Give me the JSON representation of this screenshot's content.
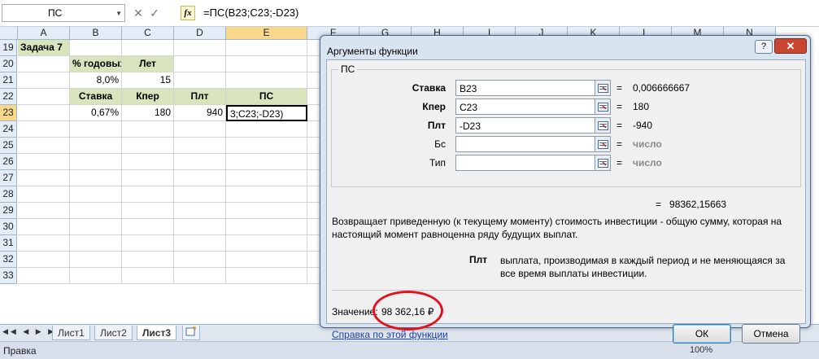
{
  "formula_bar": {
    "name_box": "ПС",
    "cancel_glyph": "✕",
    "enter_glyph": "✓",
    "fx_label": "fx",
    "formula": "=ПС(B23;C23;-D23)"
  },
  "grid": {
    "columns": [
      "A",
      "B",
      "C",
      "D",
      "E",
      "F",
      "G",
      "H",
      "I",
      "J",
      "K",
      "L",
      "M",
      "N"
    ],
    "rows": [
      "19",
      "20",
      "21",
      "22",
      "23",
      "24",
      "25",
      "26",
      "27",
      "28",
      "29",
      "30",
      "31",
      "32",
      "33"
    ],
    "cells": {
      "A19": "Задача 7",
      "B20": "% годовых",
      "C20": "Лет",
      "B21": "8,0%",
      "C21": "15",
      "B22": "Ставка",
      "C22": "Кпер",
      "D22": "Плт",
      "E22": "ПС",
      "B23": "0,67%",
      "C23": "180",
      "D23": "940",
      "E23": "3;C23;-D23)"
    }
  },
  "sheet_tabs": [
    "Лист1",
    "Лист2",
    "Лист3"
  ],
  "status": {
    "mode": "Правка",
    "zoom": "100%"
  },
  "dialog": {
    "title": "Аргументы функции",
    "help_glyph": "?",
    "close_glyph": "✕",
    "function_name": "ПС",
    "args": [
      {
        "label": "Ставка",
        "value": "B23",
        "result": "0,006666667",
        "bold": true
      },
      {
        "label": "Кпер",
        "value": "C23",
        "result": "180",
        "bold": true
      },
      {
        "label": "Плт",
        "value": "-D23",
        "result": "-940",
        "bold": true
      },
      {
        "label": "Бс",
        "value": "",
        "result": "число",
        "bold": false
      },
      {
        "label": "Тип",
        "value": "",
        "result": "число",
        "bold": false
      }
    ],
    "equals": "=",
    "total": "98362,15663",
    "description": "Возвращает приведенную (к текущему моменту) стоимость инвестиции - общую сумму, которая на настоящий момент равноценна ряду будущих выплат.",
    "arg_help_label": "Плт",
    "arg_help_text": "выплата, производимая в каждый период и не меняющаяся за все время выплаты инвестиции.",
    "value_label": "Значение:",
    "value": "98 362,16 ₽",
    "help_link": "Справка по этой функции",
    "ok_label": "ОК",
    "cancel_label": "Отмена"
  },
  "colors": {
    "header_green": "#d8e4bc",
    "selection_header": "#f8d88a",
    "annotation_circle": "#e0141e"
  }
}
